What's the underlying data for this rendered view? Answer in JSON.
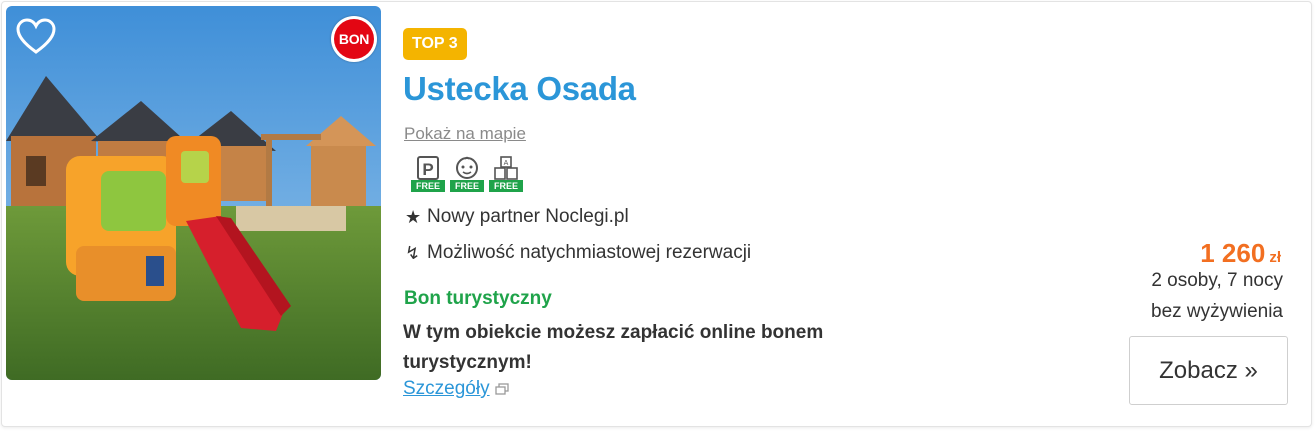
{
  "listing": {
    "top_badge": "TOP 3",
    "name": "Ustecka Osada",
    "map_link": "Pokaż na mapie",
    "amenities": [
      {
        "icon": "parking-icon",
        "tag": "FREE"
      },
      {
        "icon": "baby-icon",
        "tag": "FREE"
      },
      {
        "icon": "toy-blocks-icon",
        "tag": "FREE"
      }
    ],
    "features": [
      {
        "icon": "star-icon",
        "glyph": "★",
        "text": "Nowy partner Noclegi.pl"
      },
      {
        "icon": "lightning-icon",
        "glyph": "↯",
        "text": "Możliwość natychmiastowej rezerwacji"
      }
    ],
    "bon": {
      "badge": "BON",
      "title": "Bon turystyczny",
      "description": "W tym obiekcie możesz zapłacić online bonem turystycznym!",
      "details_link": "Szczegóły"
    },
    "price": {
      "amount": "1 260",
      "currency": "zł",
      "persons": "2 osoby, 7 nocy",
      "board": "bez wyżywienia"
    },
    "cta": "Zobacz »",
    "colors": {
      "accent_blue": "#2b96d8",
      "badge_yellow": "#f4b400",
      "price_orange": "#f26f21",
      "bon_green": "#1fa34a",
      "bon_red": "#e30613"
    }
  }
}
